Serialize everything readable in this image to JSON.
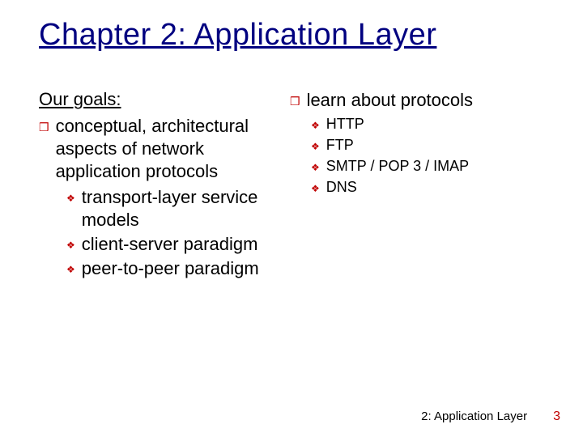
{
  "title": "Chapter 2: Application Layer",
  "goals_label": "Our goals:",
  "left": {
    "item1": "conceptual, architectural aspects of network application protocols",
    "sub": {
      "a": "transport-layer service models",
      "b": "client-server paradigm",
      "c": "peer-to-peer paradigm"
    }
  },
  "right": {
    "item1": "learn about protocols",
    "sub": {
      "a": "HTTP",
      "b": "FTP",
      "c": "SMTP / POP 3 / IMAP",
      "d": "DNS"
    }
  },
  "bullets": {
    "l1": "❒",
    "l2": "❖"
  },
  "footer": {
    "chapter": "2: Application Layer",
    "page": "3"
  }
}
